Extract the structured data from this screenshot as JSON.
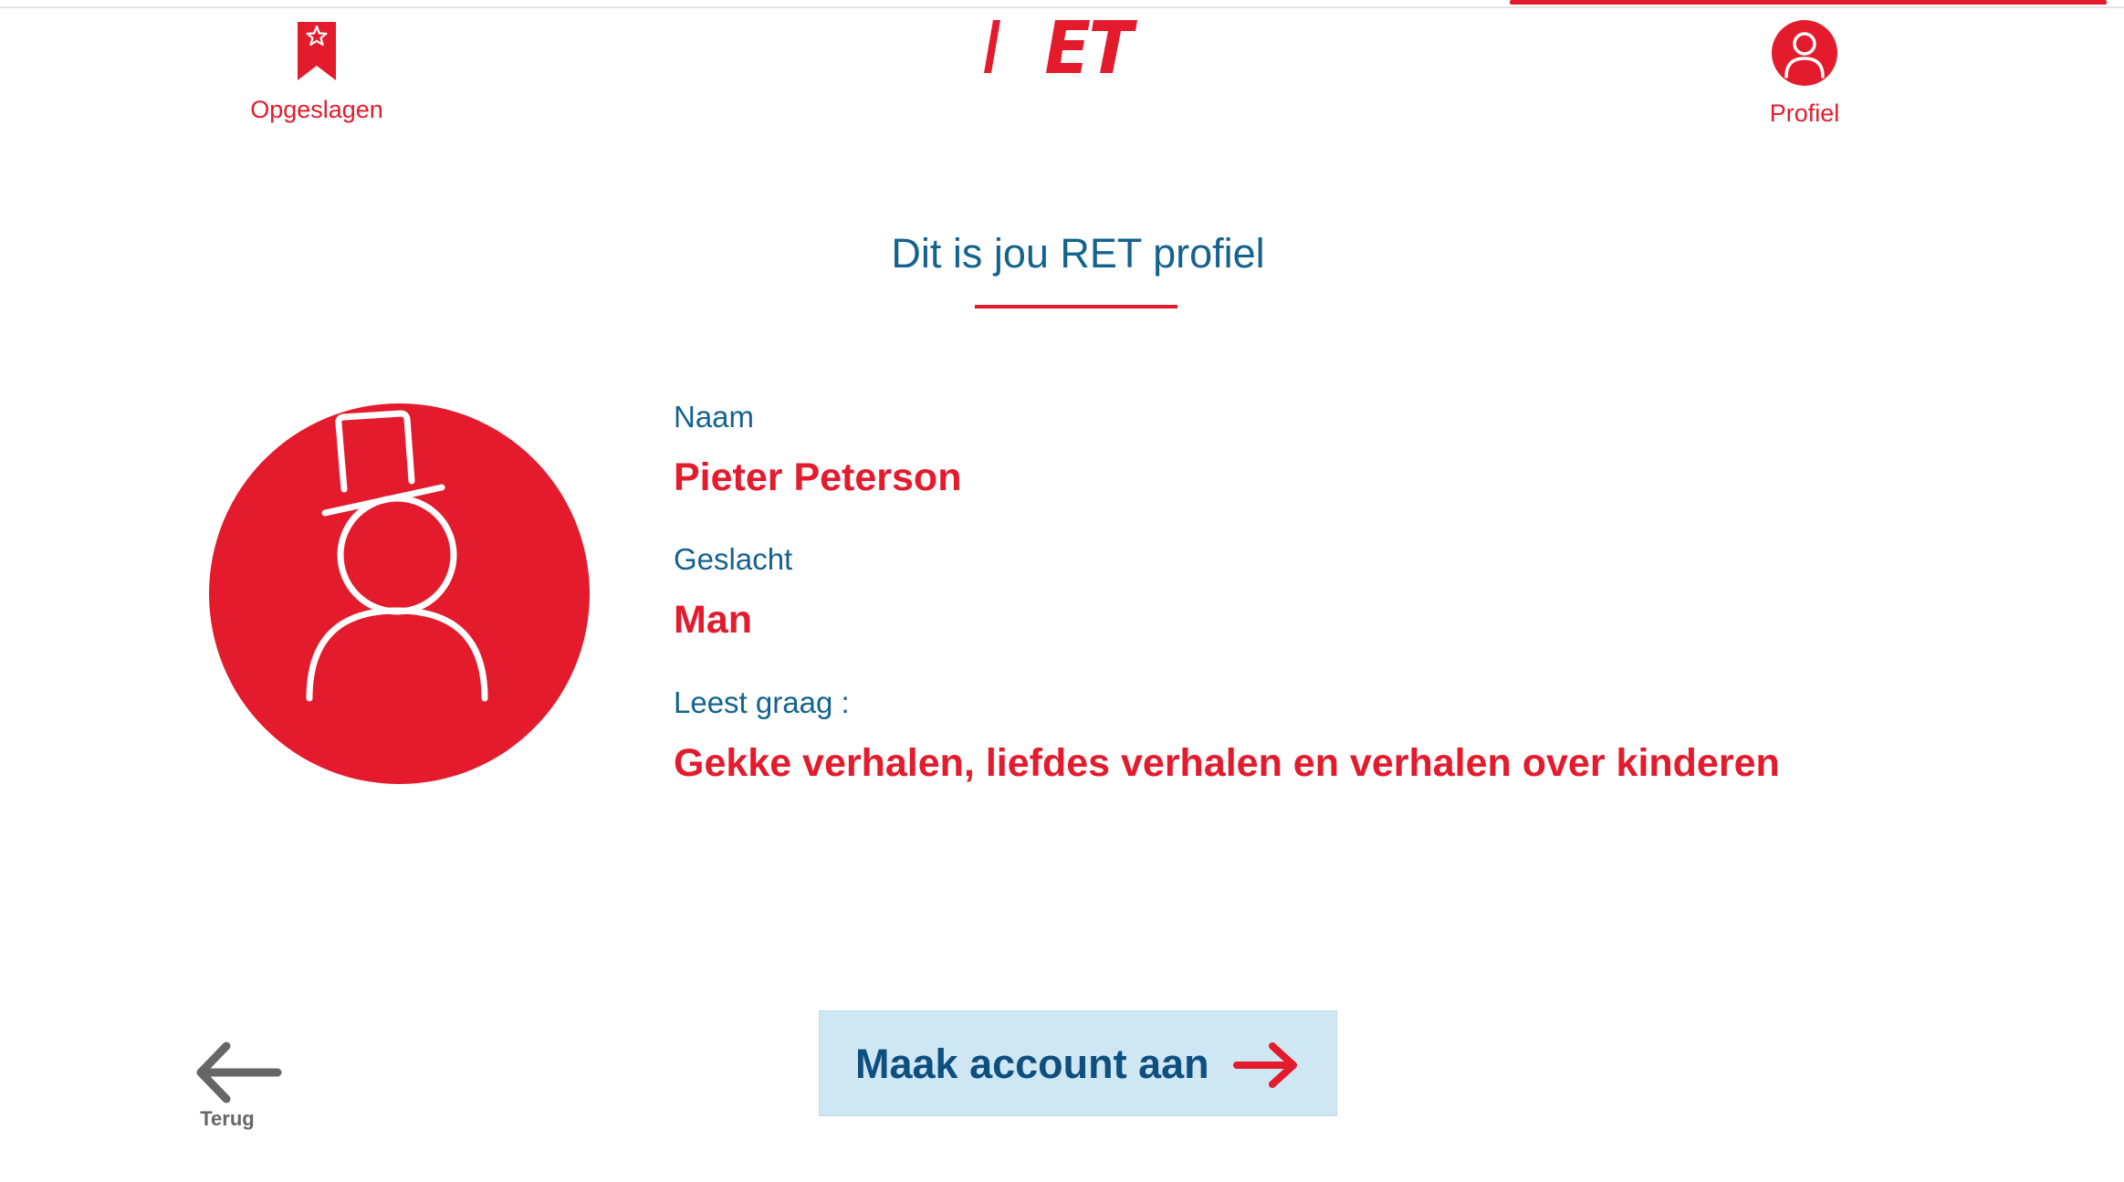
{
  "colors": {
    "brand_red": "#e31b2c",
    "heading_blue": "#14638f",
    "button_bg": "#cfe6f3",
    "button_text": "#0e4f80",
    "back_grey": "#666666"
  },
  "nav": {
    "saved": {
      "label": "Opgeslagen",
      "icon": "bookmark-star-icon"
    },
    "logo": {
      "text": "RET",
      "icon": "ret-logo"
    },
    "profile": {
      "label": "Profiel",
      "icon": "user-circle-icon",
      "active": true
    }
  },
  "page": {
    "title": "Dit is jou RET profiel"
  },
  "profile": {
    "avatar_icon": "snowman-top-hat-avatar",
    "fields": [
      {
        "label": "Naam",
        "value": "Pieter Peterson"
      },
      {
        "label": "Geslacht",
        "value": "Man"
      },
      {
        "label": "Leest graag :",
        "value": "Gekke verhalen, liefdes verhalen en verhalen over kinderen"
      }
    ]
  },
  "actions": {
    "back_label": "Terug",
    "back_icon": "arrow-left-icon",
    "create_account_label": "Maak account aan",
    "create_account_icon": "arrow-right-icon"
  }
}
